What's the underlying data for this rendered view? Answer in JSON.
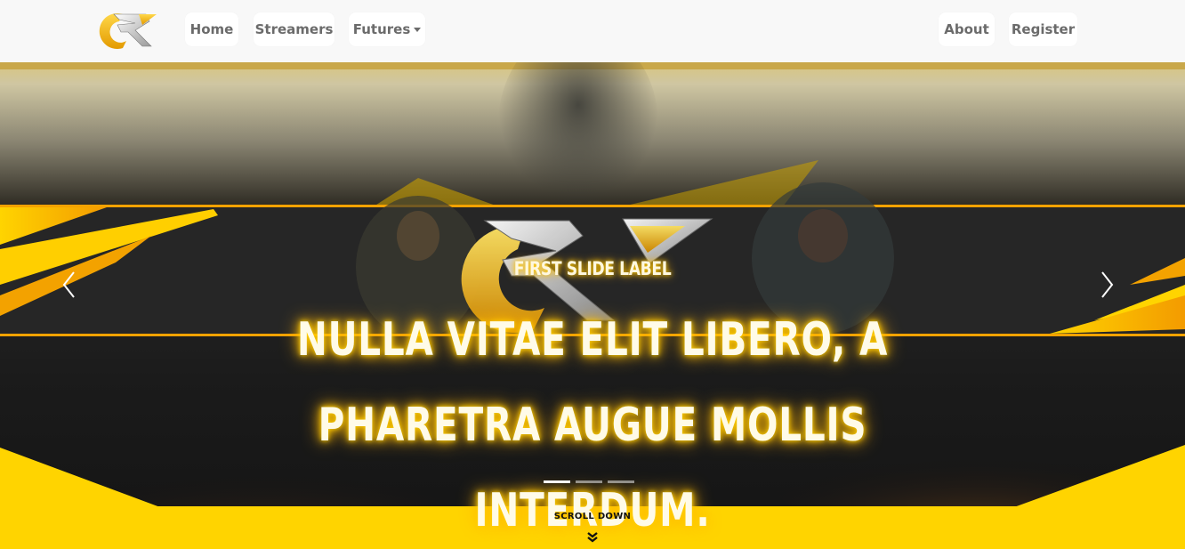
{
  "navbar": {
    "logo_text": "RK",
    "links": {
      "home": "Home",
      "streamers": "Streamers",
      "futures": "Futures",
      "about": "About",
      "register": "Register"
    }
  },
  "carousel": {
    "slide_label": "First slide label",
    "slide_text": "Nulla vitae elit libero, a pharetra augue mollis interdum.",
    "slide_count": 3,
    "active_index": 0,
    "prev_icon": "chevron-left-icon",
    "next_icon": "chevron-right-icon"
  },
  "scroll": {
    "label": "SCROLL DOWN",
    "icon": "double-chevron-down-icon"
  },
  "colors": {
    "accent": "#ffd400",
    "accent_dark": "#f2a800",
    "nav_text": "#6b6b6b",
    "nav_bg": "#f8f8f8"
  }
}
